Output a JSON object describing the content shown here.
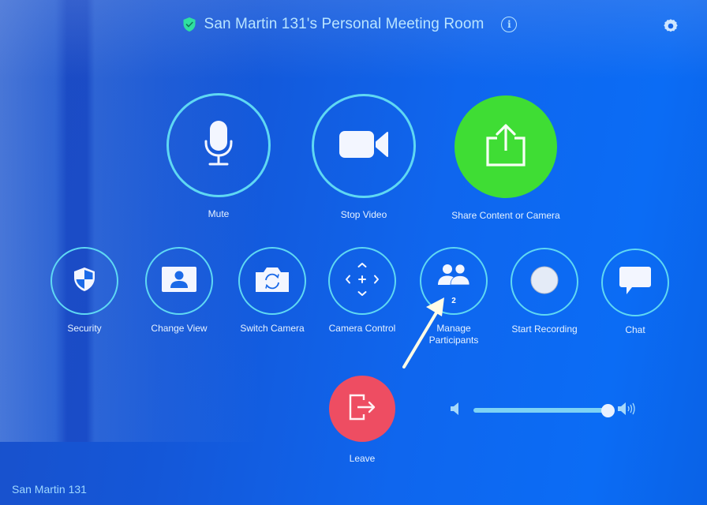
{
  "header": {
    "title": "San Martin 131's Personal Meeting Room",
    "secure_icon": "shield-check-icon",
    "info_icon": "info-icon",
    "info_glyph": "i",
    "settings_icon": "gear-icon"
  },
  "primary_controls": [
    {
      "id": "mute",
      "label": "Mute",
      "icon": "microphone-icon"
    },
    {
      "id": "stop-video",
      "label": "Stop Video",
      "icon": "video-camera-icon"
    },
    {
      "id": "share",
      "label": "Share Content or Camera",
      "icon": "share-upload-icon",
      "color": "#3fdd34"
    }
  ],
  "secondary_controls": [
    {
      "id": "security",
      "label": "Security",
      "icon": "security-shield-icon"
    },
    {
      "id": "change-view",
      "label": "Change View",
      "icon": "speaker-view-icon"
    },
    {
      "id": "switch-camera",
      "label": "Switch Camera",
      "icon": "switch-camera-icon"
    },
    {
      "id": "camera-control",
      "label": "Camera Control",
      "icon": "pan-tilt-zoom-icon"
    },
    {
      "id": "manage-participants",
      "label": "Manage Participants",
      "label_line1": "Manage",
      "label_line2": "Participants",
      "icon": "participants-icon",
      "count": "2"
    },
    {
      "id": "start-recording",
      "label": "Start Recording",
      "icon": "record-icon"
    },
    {
      "id": "chat",
      "label": "Chat",
      "icon": "chat-bubble-icon"
    }
  ],
  "leave": {
    "label": "Leave",
    "icon": "exit-icon",
    "color": "#ee4d62"
  },
  "volume": {
    "level_percent": 100,
    "min_icon": "speaker-low-icon",
    "max_icon": "speaker-high-icon"
  },
  "footer": {
    "room_name": "San Martin 131"
  },
  "annotation": {
    "type": "arrow",
    "points_to": "manage-participants",
    "color": "#fffbe6"
  },
  "colors": {
    "accent_ring": "#5fd8f3",
    "share_green": "#3fdd34",
    "leave_red": "#ee4d62",
    "title_text": "#b9e4ff",
    "secure_green": "#2fe0a0"
  }
}
